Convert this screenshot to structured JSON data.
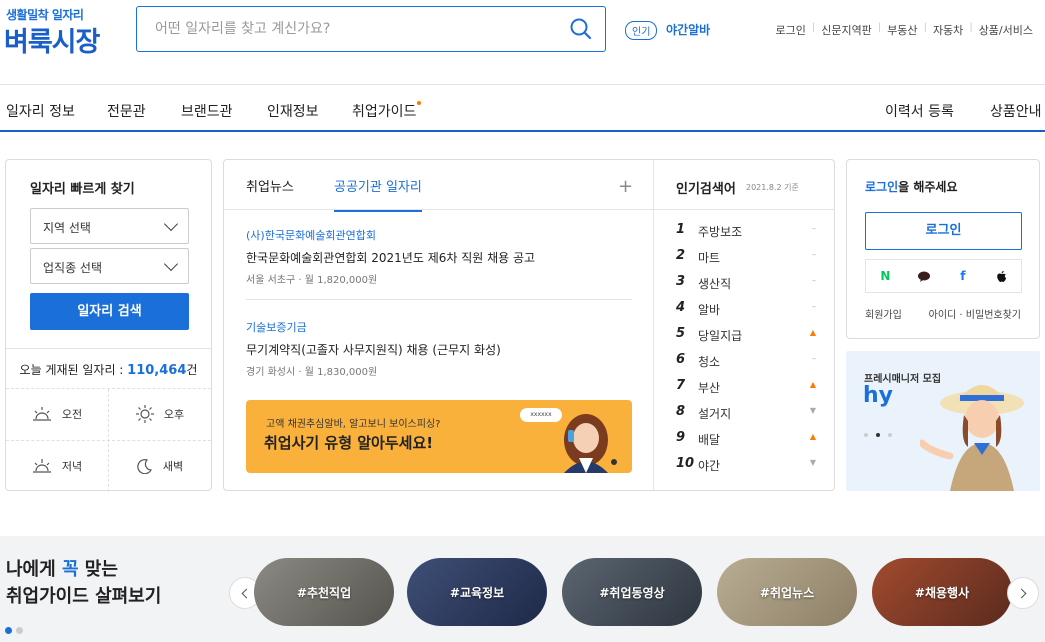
{
  "brand": {
    "sub": "생활밀착 일자리",
    "name": "벼룩시장"
  },
  "search": {
    "placeholder": "어떤 일자리를 찾고 계신가요?",
    "popular_badge": "인기",
    "popular_word": "야간알바"
  },
  "util_links": [
    "로그인",
    "신문지역판",
    "부동산",
    "자동차",
    "상품/서비스"
  ],
  "nav": {
    "left": [
      "일자리 정보",
      "전문관",
      "브랜드관",
      "인재정보",
      "취업가이드"
    ],
    "right": [
      "이력서 등록",
      "상품안내"
    ]
  },
  "quick": {
    "title": "일자리 빠르게 찾기",
    "region": "지역 선택",
    "job": "업직종 선택",
    "button": "일자리 검색",
    "count_label": "오늘 게재된 일자리 : ",
    "count_value": "110,464",
    "count_unit": "건",
    "times": [
      "오전",
      "오후",
      "저녁",
      "새벽"
    ]
  },
  "news": {
    "tabs": [
      "취업뉴스",
      "공공기관 일자리"
    ],
    "plus": "+",
    "items": [
      {
        "org": "(사)한국문화예술회관연합회",
        "title": "한국문화예술회관연합회 2021년도 제6차 직원 채용 공고",
        "location": "서울 서초구",
        "wage": "월 1,820,000원"
      },
      {
        "org": "기술보증기금",
        "title": "무기계약직(고졸자 사무지원직) 채용 (근무지 화성)",
        "location": "경기 화성시",
        "wage": "월 1,830,000원"
      }
    ],
    "banner": {
      "line1": "고액 채권추심알바, 알고보니 보이스피싱?",
      "line2": "취업사기 유형 알아두세요!",
      "bubble": "xxxxxx"
    }
  },
  "ranking": {
    "title": "인기검색어",
    "date": "2021.8.2 기준",
    "items": [
      {
        "rank": "1",
        "word": "주방보조",
        "trend": "–"
      },
      {
        "rank": "2",
        "word": "마트",
        "trend": "–"
      },
      {
        "rank": "3",
        "word": "생산직",
        "trend": "–"
      },
      {
        "rank": "4",
        "word": "알바",
        "trend": "–"
      },
      {
        "rank": "5",
        "word": "당일지급",
        "trend": "▲"
      },
      {
        "rank": "6",
        "word": "청소",
        "trend": "–"
      },
      {
        "rank": "7",
        "word": "부산",
        "trend": "▲"
      },
      {
        "rank": "8",
        "word": "설거지",
        "trend": "▼"
      },
      {
        "rank": "9",
        "word": "배달",
        "trend": "▲"
      },
      {
        "rank": "10",
        "word": "야간",
        "trend": "▼"
      }
    ]
  },
  "login": {
    "title_hl": "로그인",
    "title_rest": "을 해주세요",
    "button": "로그인",
    "sns": [
      "N",
      "●",
      "f",
      ""
    ],
    "join": "회원가입",
    "find": "아이디 · 비밀번호찾기"
  },
  "ad": {
    "line1": "프레시매니저 모집",
    "logo": "hy"
  },
  "guide": {
    "line1_a": "나에게 ",
    "line1_hl": "꼭",
    "line1_b": " 맞는",
    "line2": "취업가이드 살펴보기",
    "pills": [
      "#추천직업",
      "#교육정보",
      "#취업동영상",
      "#취업뉴스",
      "#채용행사"
    ]
  },
  "colors": {
    "accent": "#1a6fd8",
    "banner": "#f9b13b",
    "up": "#ff7a00",
    "down": "#aaaaaa"
  }
}
